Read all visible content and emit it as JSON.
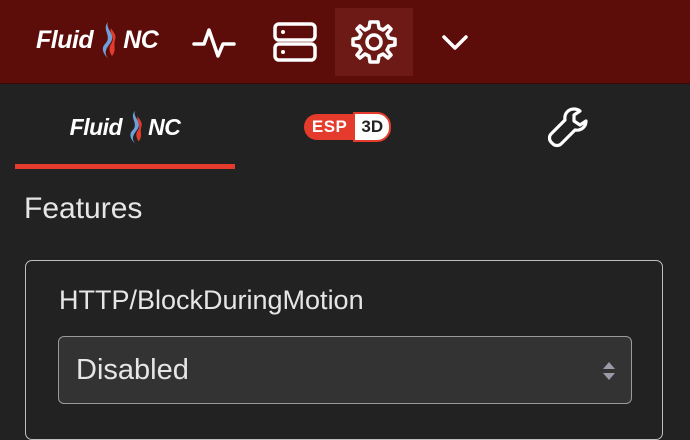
{
  "topbar": {
    "brand": {
      "part1": "Fluid",
      "part2": "NC"
    },
    "nav": [
      {
        "name": "activity-icon"
      },
      {
        "name": "server-icon"
      },
      {
        "name": "settings-gear-icon",
        "active": true
      },
      {
        "name": "chevron-down-icon"
      }
    ]
  },
  "tabs": [
    {
      "part1": "Fluid",
      "part2": "NC",
      "active": true
    },
    {
      "esp": "ESP",
      "d3": "3D"
    },
    {
      "icon": "wrench-icon"
    }
  ],
  "section": {
    "title": "Features"
  },
  "setting": {
    "label": "HTTP/BlockDuringMotion",
    "value": "Disabled"
  },
  "colors": {
    "topbar": "#5c0d0a",
    "accent": "#e53b2c",
    "background": "#222222"
  }
}
